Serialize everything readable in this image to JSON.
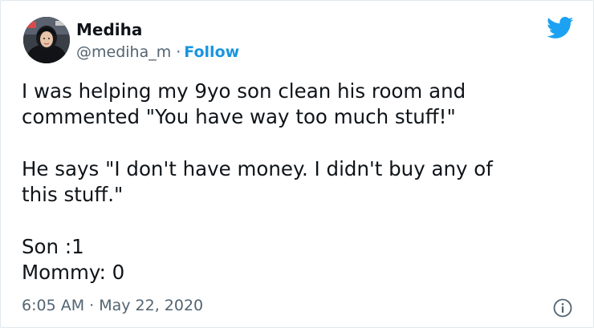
{
  "tweet": {
    "author": {
      "display_name": "Mediha",
      "handle": "@mediha_m",
      "separator": "·",
      "follow_label": "Follow",
      "avatar_icon": "profile-photo-icon"
    },
    "brand_icon": "twitter-bird-icon",
    "brand_color": "#1da1f2",
    "link_color": "#1b95e0",
    "text": {
      "line1": "I was helping my 9yo son clean his room and",
      "line2": "commented \"You have way too much stuff!\"",
      "line3": "He says \"I don't have money. I didn't buy any of",
      "line4": "this stuff.\"",
      "line5": "Son :1",
      "line6": "Mommy: 0"
    },
    "timestamp": "6:05 AM · May 22, 2020",
    "info_icon": "info-icon"
  }
}
